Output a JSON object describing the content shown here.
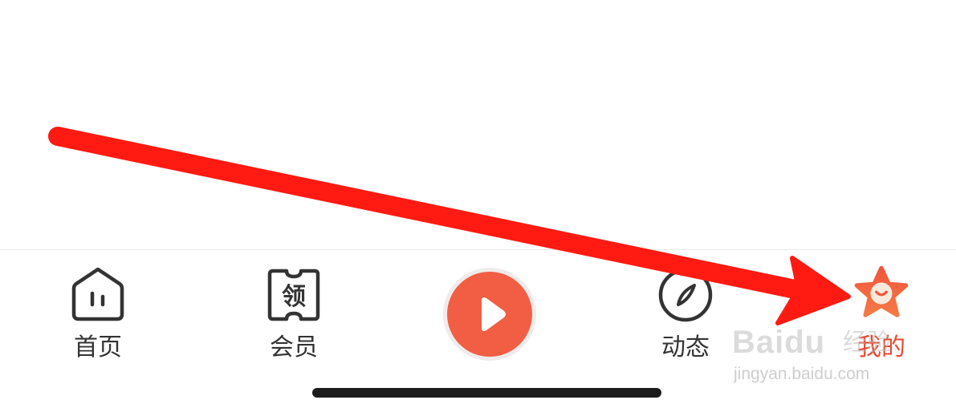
{
  "tabbar": {
    "tabs": [
      {
        "label": "首页",
        "icon": "home-icon"
      },
      {
        "label": "会员",
        "icon": "ticket-icon",
        "icon_text": "领"
      },
      {
        "label": "动态",
        "icon": "compass-icon"
      },
      {
        "label": "我的",
        "icon": "star-face-icon",
        "active": true
      }
    ],
    "center_button": {
      "icon": "play-icon"
    }
  },
  "annotation": {
    "type": "arrow",
    "color": "#ff1a12"
  },
  "watermark": {
    "logo": "Baidu",
    "cn": "经验",
    "url": "jingyan.baidu.com"
  },
  "colors": {
    "accent": "#f15e44",
    "active_label": "#e8492f",
    "icon_stroke": "#333333",
    "indicator": "#1c1c1c"
  }
}
